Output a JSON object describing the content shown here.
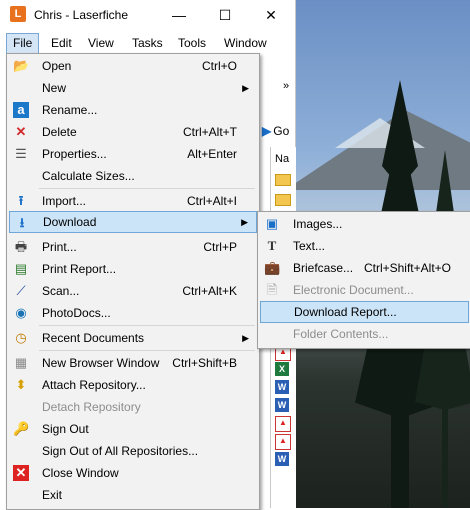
{
  "window": {
    "logo": "L",
    "title": "Chris - Laserfiche",
    "minimize": "—",
    "maximize": "☐",
    "close": "✕"
  },
  "menubar": [
    "File",
    "Edit",
    "View",
    "Tasks",
    "Tools",
    "Window"
  ],
  "toolbar": {
    "chevron": "»",
    "go_label": "Go"
  },
  "list": {
    "header": "Na"
  },
  "file_menu": {
    "open": {
      "label": "Open",
      "shortcut": "Ctrl+O"
    },
    "new": {
      "label": "New"
    },
    "rename": {
      "label": "Rename..."
    },
    "delete": {
      "label": "Delete",
      "shortcut": "Ctrl+Alt+T"
    },
    "properties": {
      "label": "Properties...",
      "shortcut": "Alt+Enter"
    },
    "calc_sizes": {
      "label": "Calculate Sizes..."
    },
    "import": {
      "label": "Import...",
      "shortcut": "Ctrl+Alt+I"
    },
    "download": {
      "label": "Download"
    },
    "print": {
      "label": "Print...",
      "shortcut": "Ctrl+P"
    },
    "print_report": {
      "label": "Print Report..."
    },
    "scan": {
      "label": "Scan...",
      "shortcut": "Ctrl+Alt+K"
    },
    "photodocs": {
      "label": "PhotoDocs..."
    },
    "recent": {
      "label": "Recent Documents"
    },
    "new_browser": {
      "label": "New Browser Window",
      "shortcut": "Ctrl+Shift+B"
    },
    "attach_repo": {
      "label": "Attach Repository..."
    },
    "detach_repo": {
      "label": "Detach Repository"
    },
    "sign_out": {
      "label": "Sign Out"
    },
    "sign_out_all": {
      "label": "Sign Out of All Repositories..."
    },
    "close_window": {
      "label": "Close Window"
    },
    "exit": {
      "label": "Exit"
    }
  },
  "download_menu": {
    "images": {
      "label": "Images..."
    },
    "text": {
      "label": "Text..."
    },
    "briefcase": {
      "label": "Briefcase...",
      "shortcut": "Ctrl+Shift+Alt+O"
    },
    "electronic": {
      "label": "Electronic Document..."
    },
    "report": {
      "label": "Download Report..."
    },
    "folder_contents": {
      "label": "Folder Contents..."
    }
  },
  "colors": {
    "highlight": "#cce4f7",
    "highlight_border": "#6fa7d8",
    "menu_bg": "#f2f2f2",
    "disabled_text": "#8d8d8d",
    "logo": "#e8711d"
  }
}
